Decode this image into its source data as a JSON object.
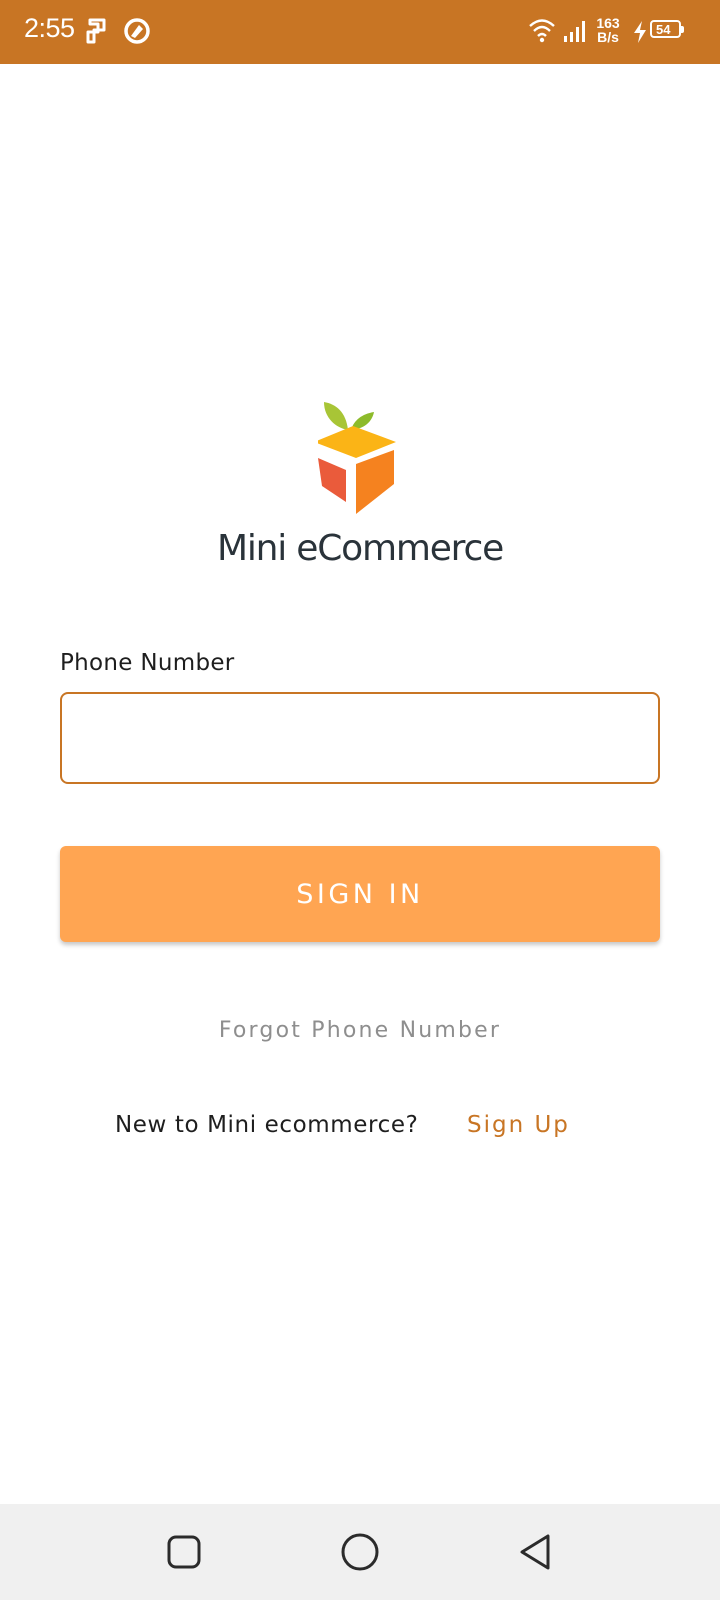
{
  "status_bar": {
    "time": "2:55",
    "net_speed_value": "163",
    "net_speed_unit": "B/s",
    "battery_level": "54",
    "icons": [
      "app-notification-icon",
      "sync-icon",
      "wifi-icon",
      "signal-icon",
      "charging-icon",
      "battery-icon"
    ]
  },
  "app": {
    "name": "Mini eCommerce",
    "logo": "mini-ecommerce-box-logo"
  },
  "form": {
    "phone_label": "Phone Number",
    "phone_value": "",
    "phone_placeholder": "",
    "sign_in_label": "SIGN IN",
    "forgot_label": "Forgot Phone Number",
    "new_user_text": "New to Mini ecommerce?",
    "sign_up_label": "Sign Up"
  },
  "nav_bar": {
    "items": [
      "recents-square-icon",
      "home-circle-icon",
      "back-triangle-icon"
    ]
  },
  "colors": {
    "accent": "#c87524",
    "button": "#ffa552",
    "link_muted": "#8e8e8e",
    "nav_background": "#f0f0f0"
  }
}
